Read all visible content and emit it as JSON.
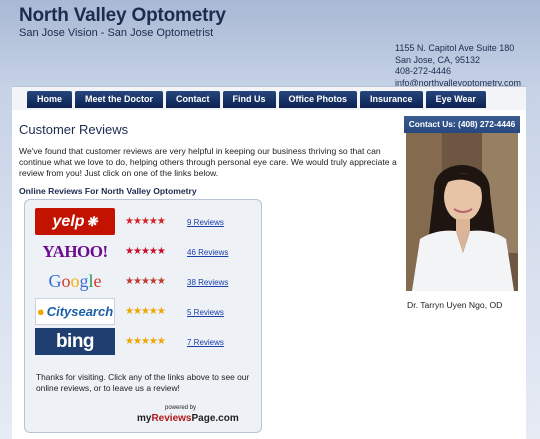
{
  "header": {
    "title": "North Valley Optometry",
    "tagline": "San Jose Vision - San Jose Optometrist",
    "address": {
      "street": "1155 N. Capitol Ave Suite 180",
      "city": "San Jose, CA, 95132",
      "phone": "408-272-4446",
      "email": "info@northvalleyoptometry.com"
    }
  },
  "nav": [
    {
      "label": "Home"
    },
    {
      "label": "Meet the Doctor"
    },
    {
      "label": "Contact"
    },
    {
      "label": "Find Us"
    },
    {
      "label": "Office Photos"
    },
    {
      "label": "Insurance"
    },
    {
      "label": "Eye Wear"
    }
  ],
  "main": {
    "title": "Customer Reviews",
    "intro": "We've found that customer reviews are very helpful in keeping our business thriving so that can continue what we love to do,  helping others through personal eye care.  We would truly appreciate a review from you!  Just click on one of the links below.",
    "reviews_heading": "Online Reviews For North Valley Optometry",
    "reviews": [
      {
        "site": "yelp",
        "logo_text": "yelp",
        "stars": 5,
        "star_color": "#d32323",
        "link": "9 Reviews"
      },
      {
        "site": "yahoo",
        "logo_text": "YAHOO!",
        "stars": 5,
        "star_color": "#c8102e",
        "link": "46 Reviews"
      },
      {
        "site": "google",
        "logo_text": "Google",
        "stars": 5,
        "star_color": "#c0392b",
        "link": "38 Reviews"
      },
      {
        "site": "citysearch",
        "logo_text": "Citysearch",
        "stars": 5,
        "star_color": "#f0a500",
        "link": "5 Reviews"
      },
      {
        "site": "bing",
        "logo_text": "bing",
        "stars": 5,
        "star_color": "#f0a500",
        "link": "7 Reviews"
      }
    ],
    "thanks": "Thanks for visiting. Click any of the links above to see our online reviews, or to leave us a review!",
    "powered_by": "powered by",
    "brand_prefix": "my",
    "brand_accent": "Reviews",
    "brand_suffix": "Page.com"
  },
  "sidebar": {
    "contact": "Contact Us: (408) 272-4446",
    "doctor_name": "Dr. Tarryn Uyen Ngo, OD"
  },
  "colors": {
    "nav_bg": "#0b2150",
    "link": "#1a3ea8",
    "title": "#1c2b4e"
  }
}
